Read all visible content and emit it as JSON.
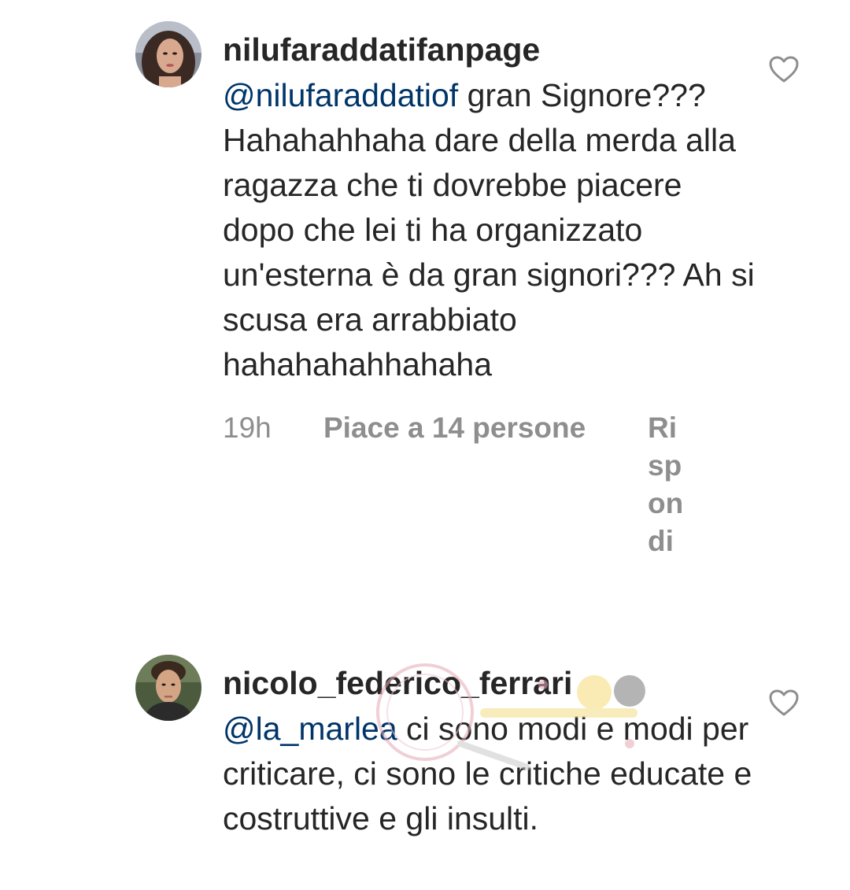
{
  "comments": [
    {
      "username": "nilufaraddatifanpage",
      "mention": "@nilufaraddatiof",
      "text": " gran Signore??? Hahahahhaha dare della merda alla ragazza che ti dovrebbe piacere dopo che lei ti ha organizzato un'esterna è da gran signori??? Ah si scusa era arrabbiato hahahahahhahaha",
      "time": "19h",
      "likes": "Piace a 14 persone",
      "reply": "Rispondi",
      "avatar_icon": "profile-photo-woman",
      "like_icon": "heart-outline-icon"
    },
    {
      "username": "nicolo_federico_ferrari",
      "mention": "@la_marlea",
      "text": " ci sono modi e modi per criticare, ci sono le critiche educate e costruttive e gli insulti.",
      "avatar_icon": "profile-photo-man",
      "like_icon": "heart-outline-icon"
    }
  ],
  "colors": {
    "text": "#262626",
    "mention": "#003569",
    "secondary": "#8e8e8e"
  }
}
